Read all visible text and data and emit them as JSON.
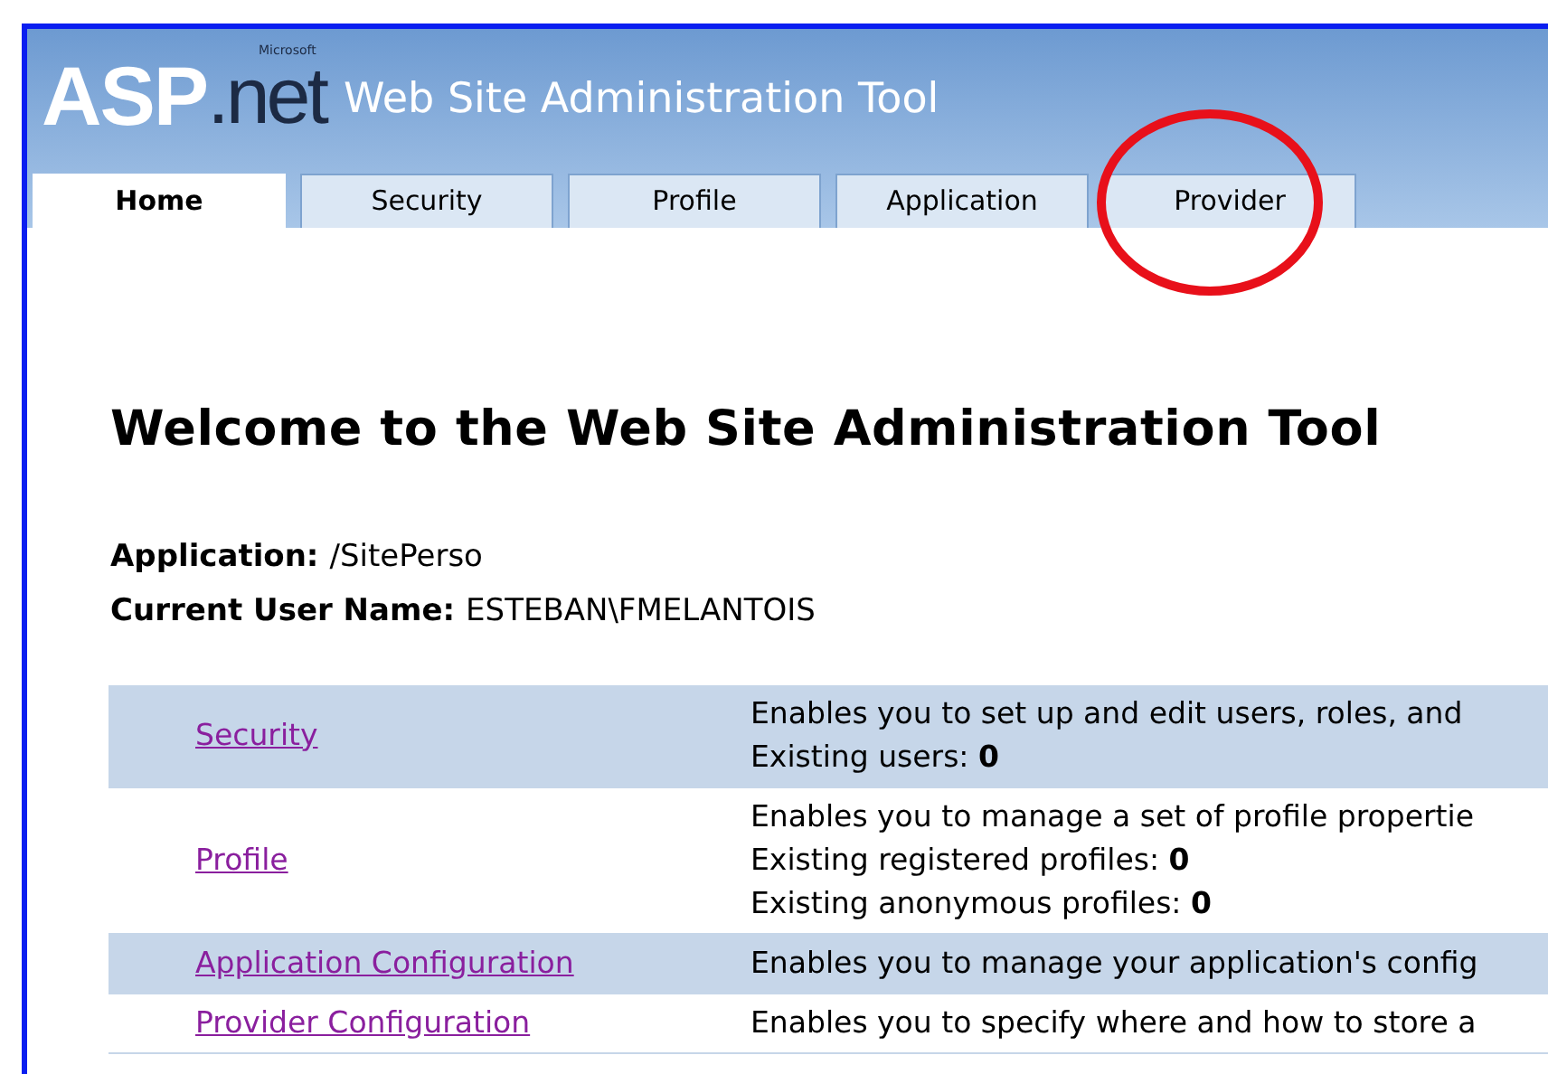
{
  "logo": {
    "small": "Microsoft",
    "main": "ASP",
    "suffix": ".net"
  },
  "window": {
    "title": "Web Site Administration Tool"
  },
  "tabs": [
    {
      "label": "Home",
      "selected": true
    },
    {
      "label": "Security",
      "selected": false
    },
    {
      "label": "Profile",
      "selected": false
    },
    {
      "label": "Application",
      "selected": false
    },
    {
      "label": "Provider",
      "selected": false,
      "circled": true
    }
  ],
  "heading": "Welcome to the Web Site Administration Tool",
  "info": [
    {
      "label": "Application:",
      "value": "/SitePerso"
    },
    {
      "label": "Current User Name:",
      "value": "ESTEBAN\\FMELANTOIS"
    }
  ],
  "sections": [
    {
      "link": "Security",
      "shaded": true,
      "lines": [
        "Enables you to set up and edit users, roles, and",
        "Existing users: **0**"
      ]
    },
    {
      "link": "Profile",
      "shaded": false,
      "lines": [
        "Enables you to manage a set of profile propertie",
        "Existing registered profiles: **0**",
        "Existing anonymous profiles: **0**"
      ]
    },
    {
      "link": "Application Configuration",
      "shaded": true,
      "lines": [
        "Enables you to manage your application's config"
      ]
    },
    {
      "link": "Provider Configuration",
      "shaded": false,
      "lines": [
        "Enables you to specify where and how to store a"
      ]
    }
  ]
}
